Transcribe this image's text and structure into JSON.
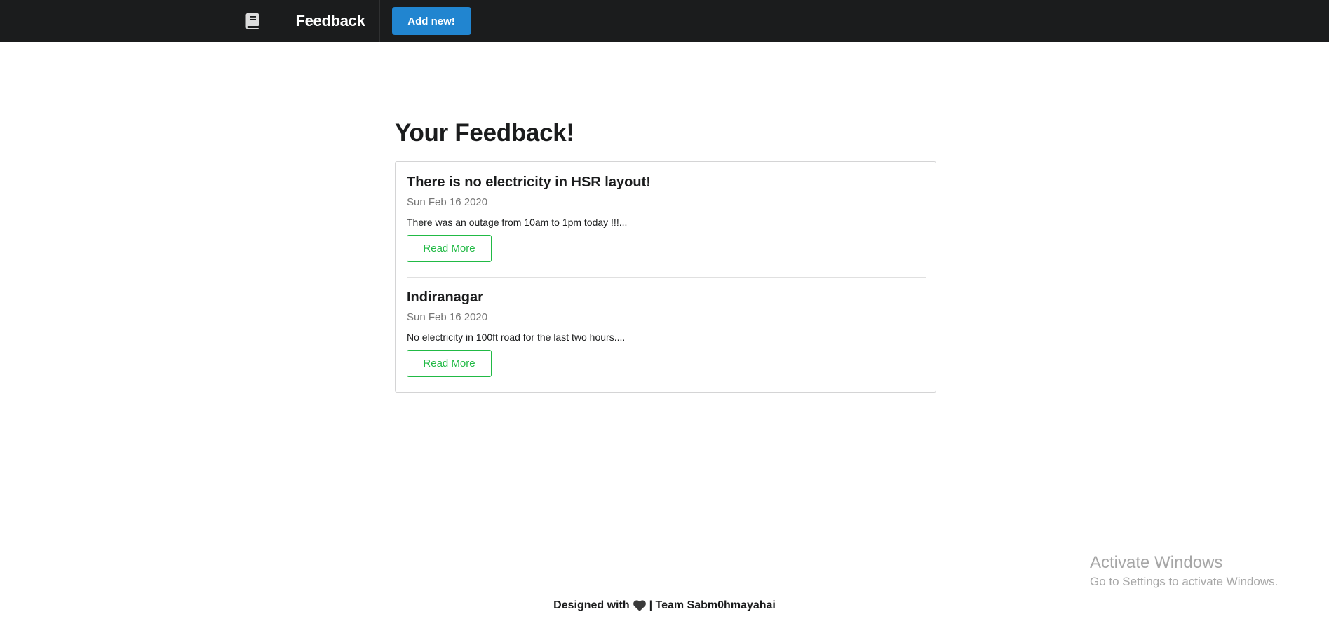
{
  "header": {
    "brand": "Feedback",
    "add_button_label": "Add new!",
    "logo_icon": "book-icon",
    "background_color": "#1b1c1d",
    "accent_color": "#2185d0"
  },
  "main": {
    "title": "Your Feedback!",
    "items": [
      {
        "title": "There is no electricity in HSR layout!",
        "date": "Sun Feb 16 2020",
        "description": "There was an outage from 10am to 1pm today !!!...",
        "read_more_label": "Read More"
      },
      {
        "title": "Indiranagar",
        "date": "Sun Feb 16 2020",
        "description": "No electricity in 100ft road for the last two hours....",
        "read_more_label": "Read More"
      }
    ],
    "button_color": "#21ba45"
  },
  "footer": {
    "designed_with": "Designed with",
    "heart_icon": "heart-icon",
    "team": "| Team Sabm0hmayahai"
  },
  "watermark": {
    "title": "Activate Windows",
    "subtitle": "Go to Settings to activate Windows."
  }
}
